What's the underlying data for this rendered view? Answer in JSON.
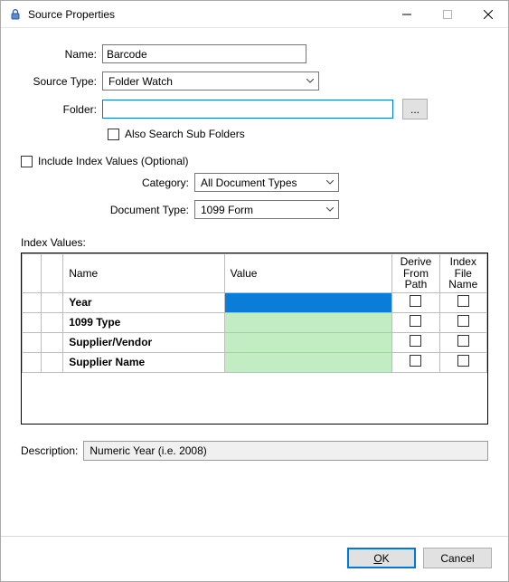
{
  "window": {
    "title": "Source Properties"
  },
  "form": {
    "name_label": "Name:",
    "name_value": "Barcode",
    "source_type_label": "Source Type:",
    "source_type_value": "Folder Watch",
    "folder_label": "Folder:",
    "folder_value": "",
    "browse_label": "...",
    "also_search_sub_label": "Also Search Sub Folders"
  },
  "include": {
    "label": "Include Index Values (Optional)",
    "category_label": "Category:",
    "category_value": "All Document Types",
    "doctype_label": "Document Type:",
    "doctype_value": "1099 Form"
  },
  "grid": {
    "label": "Index Values:",
    "headers": {
      "name": "Name",
      "value": "Value",
      "derive": "Derive\nFrom\nPath",
      "ifname": "Index\nFile\nName"
    },
    "rows": [
      {
        "name": "Year",
        "value_bg": "blue"
      },
      {
        "name": "1099 Type",
        "value_bg": "green"
      },
      {
        "name": "Supplier/Vendor",
        "value_bg": "green"
      },
      {
        "name": "Supplier Name",
        "value_bg": "green"
      }
    ]
  },
  "description": {
    "label": "Description:",
    "value": "Numeric Year (i.e. 2008)"
  },
  "buttons": {
    "ok_u": "O",
    "ok_rest": "K",
    "cancel": "Cancel"
  }
}
